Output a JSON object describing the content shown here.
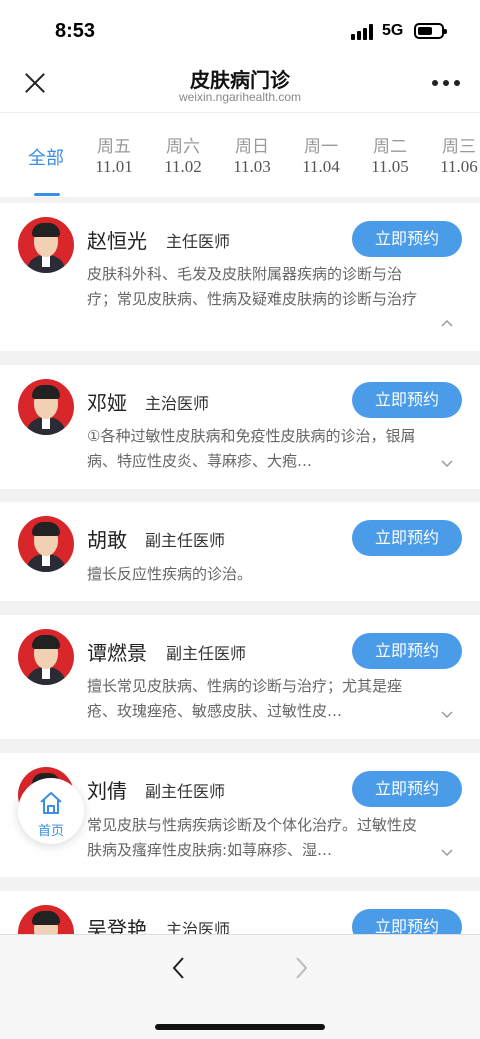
{
  "status": {
    "time": "8:53",
    "network": "5G"
  },
  "nav": {
    "title": "皮肤病门诊",
    "url": "weixin.ngarihealth.com"
  },
  "tabs": [
    {
      "day": "全部",
      "date": ""
    },
    {
      "day": "周五",
      "date": "11.01"
    },
    {
      "day": "周六",
      "date": "11.02"
    },
    {
      "day": "周日",
      "date": "11.03"
    },
    {
      "day": "周一",
      "date": "11.04"
    },
    {
      "day": "周二",
      "date": "11.05"
    },
    {
      "day": "周三",
      "date": "11.06"
    }
  ],
  "book_label": "立即预约",
  "doctors": [
    {
      "name": "赵恒光",
      "title": "主任医师",
      "desc": "皮肤科外科、毛发及皮肤附属器疾病的诊断与治疗；常见皮肤病、性病及疑难皮肤病的诊断与治疗",
      "expanded": true
    },
    {
      "name": "邓娅",
      "title": "主治医师",
      "desc": "①各种过敏性皮肤病和免疫性皮肤病的诊治，银屑病、特应性皮炎、荨麻疹、大疱…",
      "expanded": false
    },
    {
      "name": "胡敢",
      "title": "副主任医师",
      "desc": "擅长反应性疾病的诊治。",
      "expanded": null
    },
    {
      "name": "谭燃景",
      "title": "副主任医师",
      "desc": "擅长常见皮肤病、性病的诊断与治疗；尤其是痤疮、玫瑰痤疮、敏感皮肤、过敏性皮…",
      "expanded": false
    },
    {
      "name": "刘倩",
      "title": "副主任医师",
      "desc": "常见皮肤与性病疾病诊断及个体化治疗。过敏性皮肤病及瘙痒性皮肤病:如荨麻疹、湿…",
      "expanded": false
    },
    {
      "name": "吴登艳",
      "title": "主治医师",
      "desc": "",
      "expanded": null
    }
  ],
  "home_fab": {
    "label": "首页"
  }
}
